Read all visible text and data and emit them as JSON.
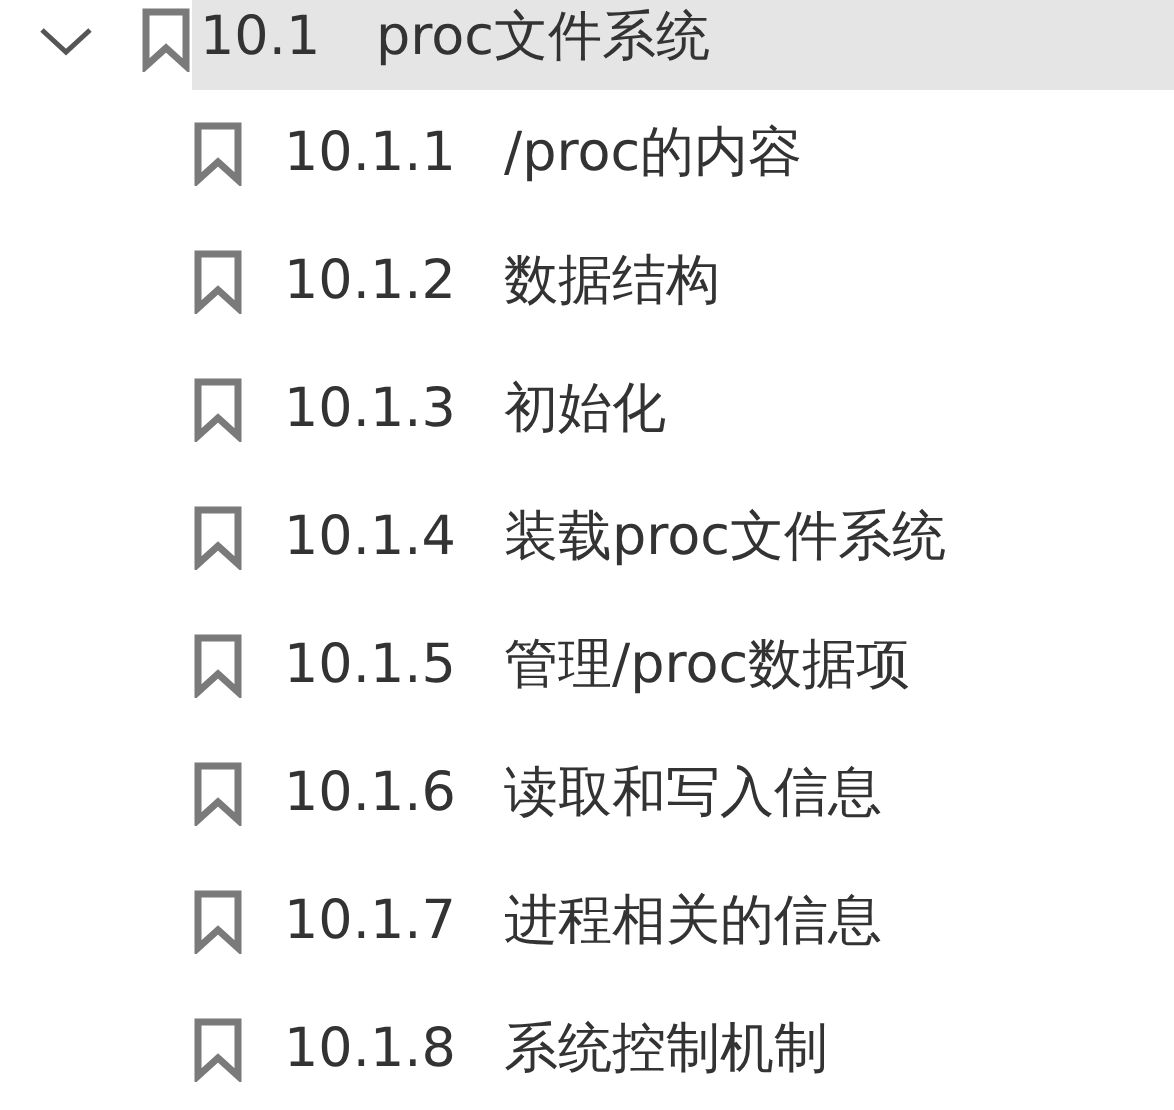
{
  "outline": [
    {
      "number": "10.1",
      "title": "proc文件系统",
      "expanded": true,
      "selected": true,
      "children": [
        {
          "number": "10.1.1",
          "title": "/proc的内容",
          "selected": false
        },
        {
          "number": "10.1.2",
          "title": "数据结构",
          "selected": false
        },
        {
          "number": "10.1.3",
          "title": "初始化",
          "selected": false
        },
        {
          "number": "10.1.4",
          "title": "装载proc文件系统",
          "selected": false
        },
        {
          "number": "10.1.5",
          "title": "管理/proc数据项",
          "selected": false
        },
        {
          "number": "10.1.6",
          "title": "读取和写入信息",
          "selected": false
        },
        {
          "number": "10.1.7",
          "title": "进程相关的信息",
          "selected": false
        },
        {
          "number": "10.1.8",
          "title": "系统控制机制",
          "selected": false
        }
      ]
    }
  ]
}
